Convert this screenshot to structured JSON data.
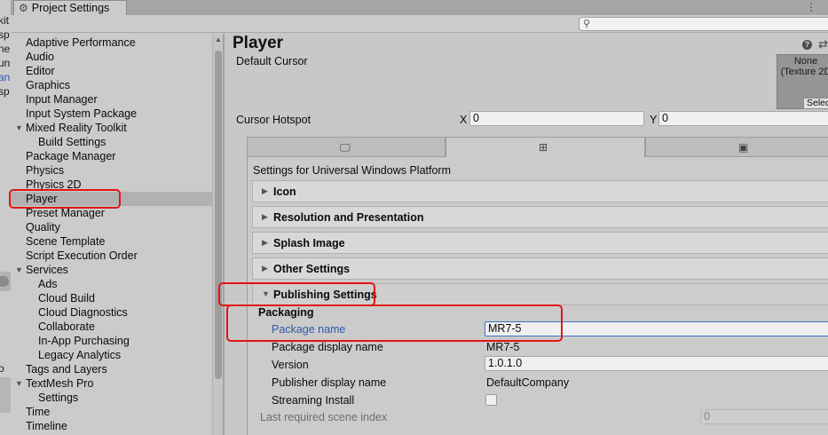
{
  "left_strip": {
    "fragments": [
      "kit",
      "sp",
      "ne",
      "un",
      "an",
      "sp",
      "o"
    ]
  },
  "window": {
    "tab_title": "Project Settings",
    "tab_icon": "gear-icon",
    "menu_icon": "kebab-menu-icon",
    "search_icon": "search-icon"
  },
  "sidebar": {
    "items": [
      {
        "label": "Adaptive Performance"
      },
      {
        "label": "Audio"
      },
      {
        "label": "Editor"
      },
      {
        "label": "Graphics"
      },
      {
        "label": "Input Manager"
      },
      {
        "label": "Input System Package"
      },
      {
        "label": "Mixed Reality Toolkit"
      },
      {
        "label": "Build Settings"
      },
      {
        "label": "Package Manager"
      },
      {
        "label": "Physics"
      },
      {
        "label": "Physics 2D"
      },
      {
        "label": "Player"
      },
      {
        "label": "Preset Manager"
      },
      {
        "label": "Quality"
      },
      {
        "label": "Scene Template"
      },
      {
        "label": "Script Execution Order"
      },
      {
        "label": "Services"
      },
      {
        "label": "Ads"
      },
      {
        "label": "Cloud Build"
      },
      {
        "label": "Cloud Diagnostics"
      },
      {
        "label": "Collaborate"
      },
      {
        "label": "In-App Purchasing"
      },
      {
        "label": "Legacy Analytics"
      },
      {
        "label": "Tags and Layers"
      },
      {
        "label": "TextMesh Pro"
      },
      {
        "label": "Settings"
      },
      {
        "label": "Time"
      },
      {
        "label": "Timeline"
      }
    ],
    "selected": "Player"
  },
  "main": {
    "title": "Player",
    "default_cursor_label": "Default Cursor",
    "cursor_texture": {
      "line1": "None",
      "line2": "(Texture 2D",
      "select_label": "Select"
    },
    "cursor_hotspot_label": "Cursor Hotspot",
    "hotspot_x_label": "X",
    "hotspot_x_value": "0",
    "hotspot_y_label": "Y",
    "hotspot_y_value": "0",
    "platform_tabs": [
      {
        "icon": "monitor-icon",
        "active": false
      },
      {
        "icon": "windows-icon",
        "active": true
      },
      {
        "icon": "android-icon",
        "active": false
      }
    ],
    "platform_heading": "Settings for Universal Windows Platform",
    "sections": [
      {
        "label": "Icon",
        "expanded": false
      },
      {
        "label": "Resolution and Presentation",
        "expanded": false
      },
      {
        "label": "Splash Image",
        "expanded": false
      },
      {
        "label": "Other Settings",
        "expanded": false
      },
      {
        "label": "Publishing Settings",
        "expanded": true
      }
    ],
    "publishing": {
      "group_label": "Packaging",
      "package_name_label": "Package name",
      "package_name_value": "MR7-5",
      "package_display_name_label": "Package display name",
      "package_display_name_value": "MR7-5",
      "version_label": "Version",
      "version_value": "1.0.1.0",
      "publisher_display_name_label": "Publisher display name",
      "publisher_display_name_value": "DefaultCompany",
      "streaming_install_label": "Streaming Install",
      "streaming_install_checked": false,
      "last_scene_index_label": "Last required scene index",
      "last_scene_index_value": "0"
    }
  },
  "colors": {
    "highlight": "#e01616",
    "link": "#2c5aa8",
    "selected_row": "#b1b1b1"
  }
}
